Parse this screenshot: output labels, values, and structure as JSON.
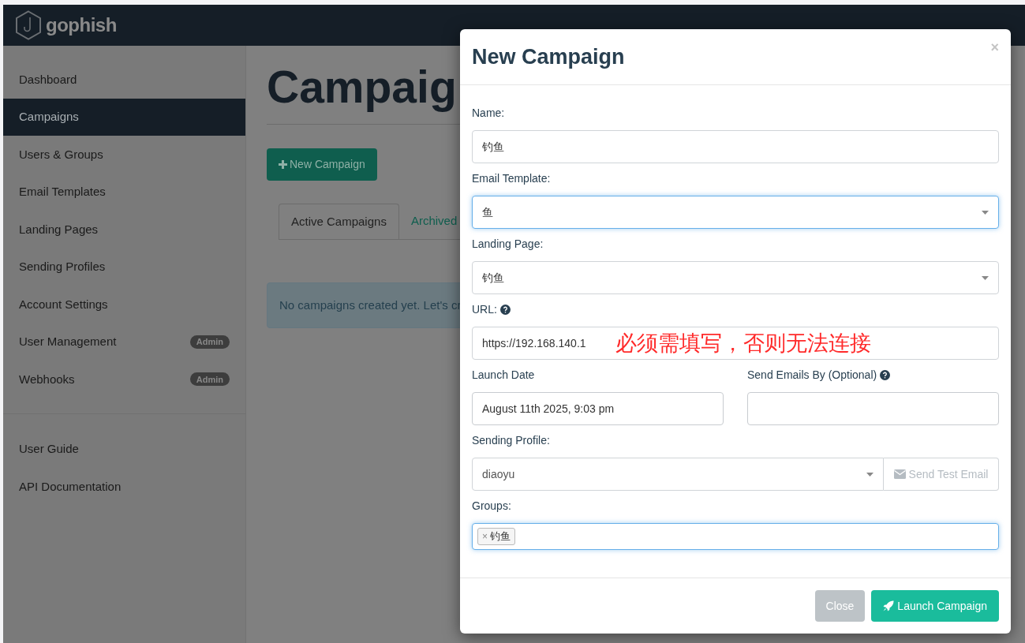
{
  "navbar": {
    "brand": "gophish"
  },
  "sidebar": {
    "items": [
      {
        "label": "Dashboard",
        "selected": false
      },
      {
        "label": "Campaigns",
        "selected": true
      },
      {
        "label": "Users & Groups",
        "selected": false
      },
      {
        "label": "Email Templates",
        "selected": false
      },
      {
        "label": "Landing Pages",
        "selected": false
      },
      {
        "label": "Sending Profiles",
        "selected": false
      },
      {
        "label": "Account Settings",
        "selected": false
      },
      {
        "label": "User Management",
        "selected": false,
        "badge": "Admin"
      },
      {
        "label": "Webhooks",
        "selected": false,
        "badge": "Admin"
      }
    ],
    "links": [
      "User Guide",
      "API Documentation"
    ]
  },
  "main": {
    "title": "Campaig",
    "new_button": "New Campaign",
    "tabs": [
      {
        "label": "Active Campaigns",
        "selected": true
      },
      {
        "label": "Archived",
        "selected": false
      }
    ],
    "alert": "No campaigns created yet. Let's cr"
  },
  "modal": {
    "title": "New Campaign",
    "close": "×",
    "fields": [
      {
        "kind": "text",
        "label": "Name:",
        "value": "钓鱼",
        "focused": false
      },
      {
        "kind": "select",
        "label": "Email Template:",
        "value": "鱼",
        "focused": true
      },
      {
        "kind": "select",
        "label": "Landing Page:",
        "value": "钓鱼",
        "focused": false
      },
      {
        "kind": "text",
        "label": "URL:",
        "help": true,
        "value": "https://192.168.140.1",
        "focused": false,
        "annotation": "必须需填写，否则无法连接"
      },
      {
        "kind": "pair",
        "items": [
          {
            "label": "Launch Date",
            "value": "August 11th 2025, 9:03 pm",
            "help": false
          },
          {
            "label": "Send Emails By (Optional)",
            "help": true
          }
        ]
      },
      {
        "kind": "select_button",
        "label": "Sending Profile:",
        "value": "diaoyu",
        "button": "Send Test Email",
        "focused": false
      },
      {
        "kind": "tags",
        "label": "Groups:",
        "tags": [
          {
            "remove": "×",
            "label": "钓鱼"
          }
        ],
        "focused": true
      }
    ],
    "buttons": [
      {
        "label": "Close",
        "kind": "secondary"
      },
      {
        "label": "Launch Campaign",
        "kind": "primary"
      }
    ]
  }
}
